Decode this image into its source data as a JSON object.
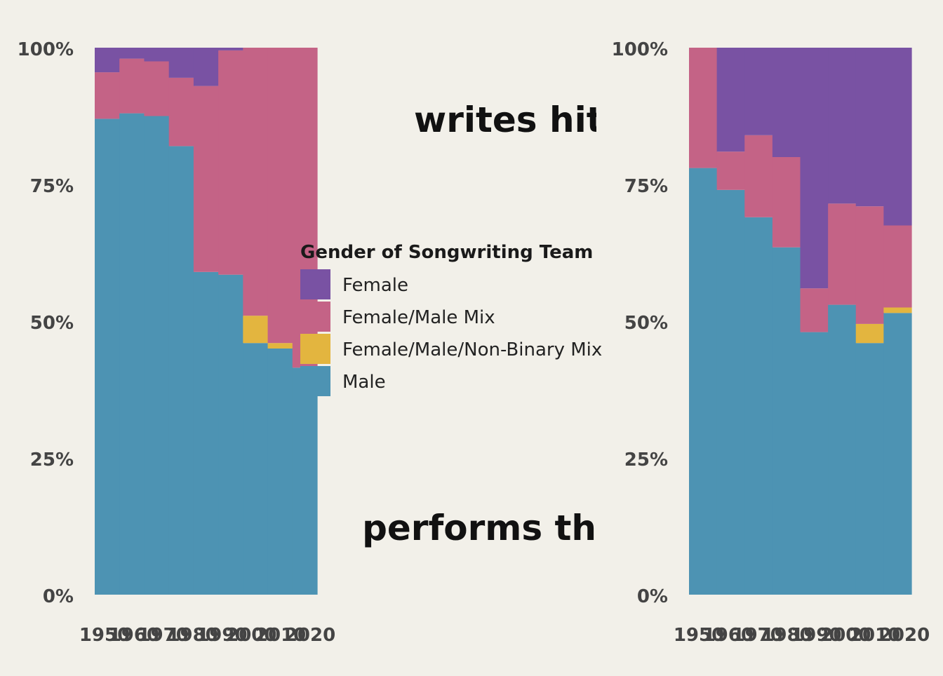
{
  "headers": {
    "top": "writes hit so",
    "bottom": "performs th"
  },
  "legend": {
    "title": "Gender of Songwriting Team",
    "items": [
      {
        "label": "Female",
        "color": "#7952a3"
      },
      {
        "label": "Female/Male Mix",
        "color": "#c46386"
      },
      {
        "label": "Female/Male/Non-Binary Mix",
        "color": "#e3b53f"
      },
      {
        "label": "Male",
        "color": "#4d93b3"
      }
    ]
  },
  "chart_data": [
    {
      "type": "area",
      "ylim": [
        0,
        100
      ],
      "yticks": [
        "0%",
        "25%",
        "50%",
        "75%",
        "100%"
      ],
      "categories": [
        "1950",
        "1960",
        "1970",
        "1980",
        "1990",
        "2000",
        "2010",
        "2020"
      ],
      "series": [
        {
          "name": "Male",
          "color": "#4d93b3",
          "values": [
            87,
            88,
            87.5,
            82,
            59,
            58.5,
            46,
            45,
            41.5
          ]
        },
        {
          "name": "Female/Male/Non-Binary Mix",
          "color": "#e3b53f",
          "values": [
            0,
            0,
            0,
            0,
            0,
            0,
            5,
            1,
            0
          ]
        },
        {
          "name": "Female/Male Mix",
          "color": "#c46386",
          "values": [
            8.5,
            10,
            10,
            12.5,
            34,
            41,
            49,
            54,
            58.5
          ]
        },
        {
          "name": "Female",
          "color": "#7952a3",
          "values": [
            4.5,
            2,
            2.5,
            5.5,
            7,
            0.5,
            0,
            0,
            0
          ]
        }
      ]
    },
    {
      "type": "area",
      "ylim": [
        0,
        100
      ],
      "yticks": [
        "0%",
        "25%",
        "50%",
        "75%",
        "100%"
      ],
      "categories": [
        "1950",
        "1960",
        "1970",
        "1980",
        "1990",
        "2000",
        "2010",
        "2020"
      ],
      "series": [
        {
          "name": "Male",
          "color": "#4d93b3",
          "values": [
            78,
            74,
            69,
            63.5,
            48,
            53,
            46,
            51.5
          ]
        },
        {
          "name": "Female/Male/Non-Binary Mix",
          "color": "#e3b53f",
          "values": [
            0,
            0,
            0,
            0,
            0,
            0,
            3.5,
            1
          ]
        },
        {
          "name": "Female/Male Mix",
          "color": "#c46386",
          "values": [
            22,
            7,
            15,
            16.5,
            8,
            18.5,
            21.5,
            15
          ]
        },
        {
          "name": "Female",
          "color": "#7952a3",
          "values": [
            0,
            19,
            16,
            20,
            44,
            28.5,
            29,
            32.5
          ]
        }
      ]
    }
  ]
}
